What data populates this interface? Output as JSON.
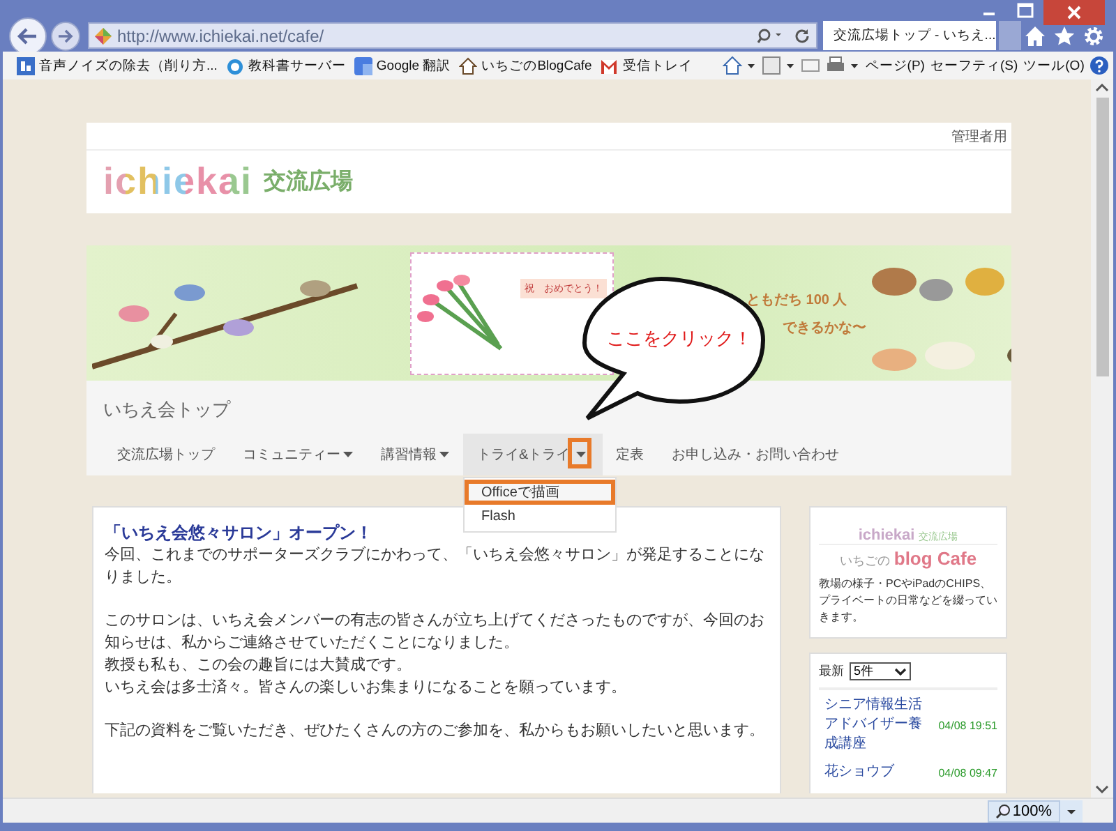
{
  "browser": {
    "address": "http://www.ichiekai.net/cafe/",
    "tabs": [
      {
        "label": "交流広場トップ - いちえ...",
        "selected": true
      }
    ],
    "favorites": [
      "音声ノイズの除去（削り方...",
      "教科書サーバー",
      "Google 翻訳",
      "いちごのBlogCafe",
      "受信トレイ"
    ],
    "commands": [
      "ページ(P)",
      "セーフティ(S)",
      "ツール(O)"
    ],
    "zoom": "100%"
  },
  "page": {
    "admin_link": "管理者用",
    "logo": {
      "latin": "ichiekai",
      "jp": "交流広場"
    },
    "banner": {
      "card_text": "祝　おめでとう！",
      "slogan": [
        "ともだち 100 人",
        "できるかな〜"
      ]
    },
    "site_title": "いちえ会トップ",
    "nav": [
      {
        "label": "交流広場トップ",
        "dropdown": false,
        "selected": false
      },
      {
        "label": "コミュニティー",
        "dropdown": true,
        "selected": false
      },
      {
        "label": "講習情報",
        "dropdown": true,
        "selected": false
      },
      {
        "label": "トライ&トライ",
        "dropdown": true,
        "selected": true
      },
      {
        "label": "定表",
        "dropdown": false,
        "selected": false
      },
      {
        "label": "お申し込み・お問い合わせ",
        "dropdown": false,
        "selected": false
      }
    ],
    "dropdown": [
      {
        "label": "Officeで描画",
        "highlighted": true
      },
      {
        "label": "Flash",
        "highlighted": false
      }
    ],
    "callout": "ここをクリック！",
    "article": {
      "title": "「いちえ会悠々サロン」オープン！",
      "paragraphs": [
        [
          "今回、これまでのサポーターズクラブにかわって、「いちえ会悠々サロン」が発足することになりました。"
        ],
        [
          "このサロンは、いちえ会メンバーの有志の皆さんが立ち上げてくださったものですが、今回のお知らせは、私からご連絡させていただくことになりました。",
          "教授も私も、この会の趣旨には大賛成です。",
          "いちえ会は多士済々。皆さんの楽しいお集まりになることを願っています。"
        ],
        [
          "下記の資料をご覧いただき、ぜひたくさんの方のご参加を、私からもお願いしたいと思います。"
        ]
      ]
    },
    "blog_card": {
      "logo": "ichiekai",
      "logo_jp": "交流広場",
      "prefix": "いちごの",
      "name": "blog Cafe",
      "description": "教場の様子・PCやiPadのCHIPS、プライベートの日常などを綴っていきます。"
    },
    "recent": {
      "label": "最新",
      "select": "5件",
      "items": [
        {
          "title": "シニア情報生活アドバイザー養成講座",
          "time": "04/08 19:51"
        },
        {
          "title": "花ショウブ",
          "time": "04/08 09:47"
        }
      ]
    }
  }
}
